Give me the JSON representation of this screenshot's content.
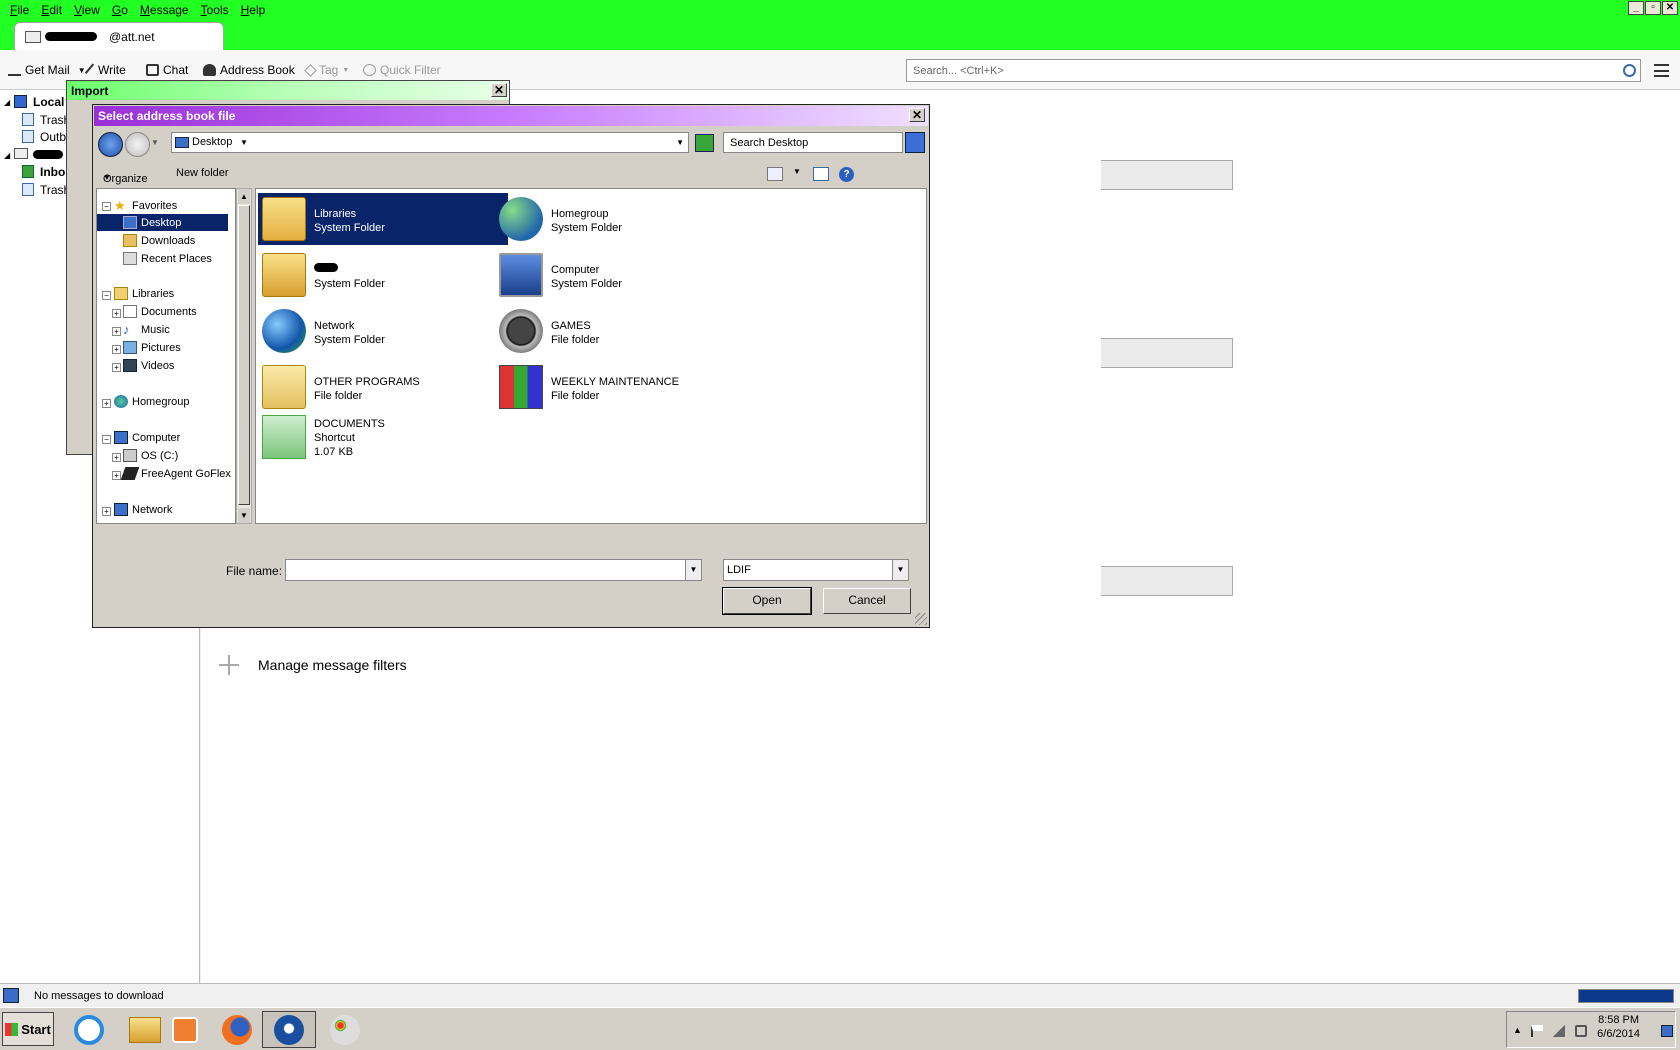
{
  "menubar": {
    "items": [
      "File",
      "Edit",
      "View",
      "Go",
      "Message",
      "Tools",
      "Help"
    ]
  },
  "account_tab": {
    "label": "@att.net"
  },
  "toolbar": {
    "get_mail": "Get Mail",
    "write": "Write",
    "chat": "Chat",
    "address_book": "Address Book",
    "tag": "Tag",
    "quick_filter": "Quick Filter"
  },
  "search": {
    "placeholder": "Search... <Ctrl+K>"
  },
  "folderpane": {
    "local": "Local",
    "trash1": "Trash",
    "outbox": "Outb",
    "inbox": "Inbo",
    "trash2": "Trash"
  },
  "content": {
    "manage_filters": "Manage message filters"
  },
  "status": {
    "text": "No messages to download"
  },
  "import_dialog": {
    "title": "Import"
  },
  "file_dialog": {
    "title": "Select address book file",
    "address": "Desktop",
    "search_placeholder": "Search Desktop",
    "organize": "Organize",
    "new_folder": "New folder",
    "nav": {
      "favorites": "Favorites",
      "desktop": "Desktop",
      "downloads": "Downloads",
      "recent": "Recent Places",
      "libraries": "Libraries",
      "documents": "Documents",
      "music": "Music",
      "pictures": "Pictures",
      "videos": "Videos",
      "homegroup": "Homegroup",
      "computer": "Computer",
      "os_c": "OS (C:)",
      "freeagent": "FreeAgent GoFlex",
      "network": "Network"
    },
    "files": [
      {
        "name": "Libraries",
        "type": "System Folder",
        "size": ""
      },
      {
        "name": "Homegroup",
        "type": "System Folder",
        "size": ""
      },
      {
        "name": "",
        "type": "System Folder",
        "size": ""
      },
      {
        "name": "Computer",
        "type": "System Folder",
        "size": ""
      },
      {
        "name": "Network",
        "type": "System Folder",
        "size": ""
      },
      {
        "name": "GAMES",
        "type": "File folder",
        "size": ""
      },
      {
        "name": "OTHER PROGRAMS",
        "type": "File folder",
        "size": ""
      },
      {
        "name": "WEEKLY MAINTENANCE",
        "type": "File folder",
        "size": ""
      },
      {
        "name": "DOCUMENTS",
        "type": "Shortcut",
        "size": "1.07 KB"
      }
    ],
    "file_name_label": "File name:",
    "file_name_value": "",
    "file_type": "LDIF",
    "open": "Open",
    "cancel": "Cancel"
  },
  "taskbar": {
    "start": "Start",
    "time": "8:58 PM",
    "date": "6/6/2014"
  }
}
